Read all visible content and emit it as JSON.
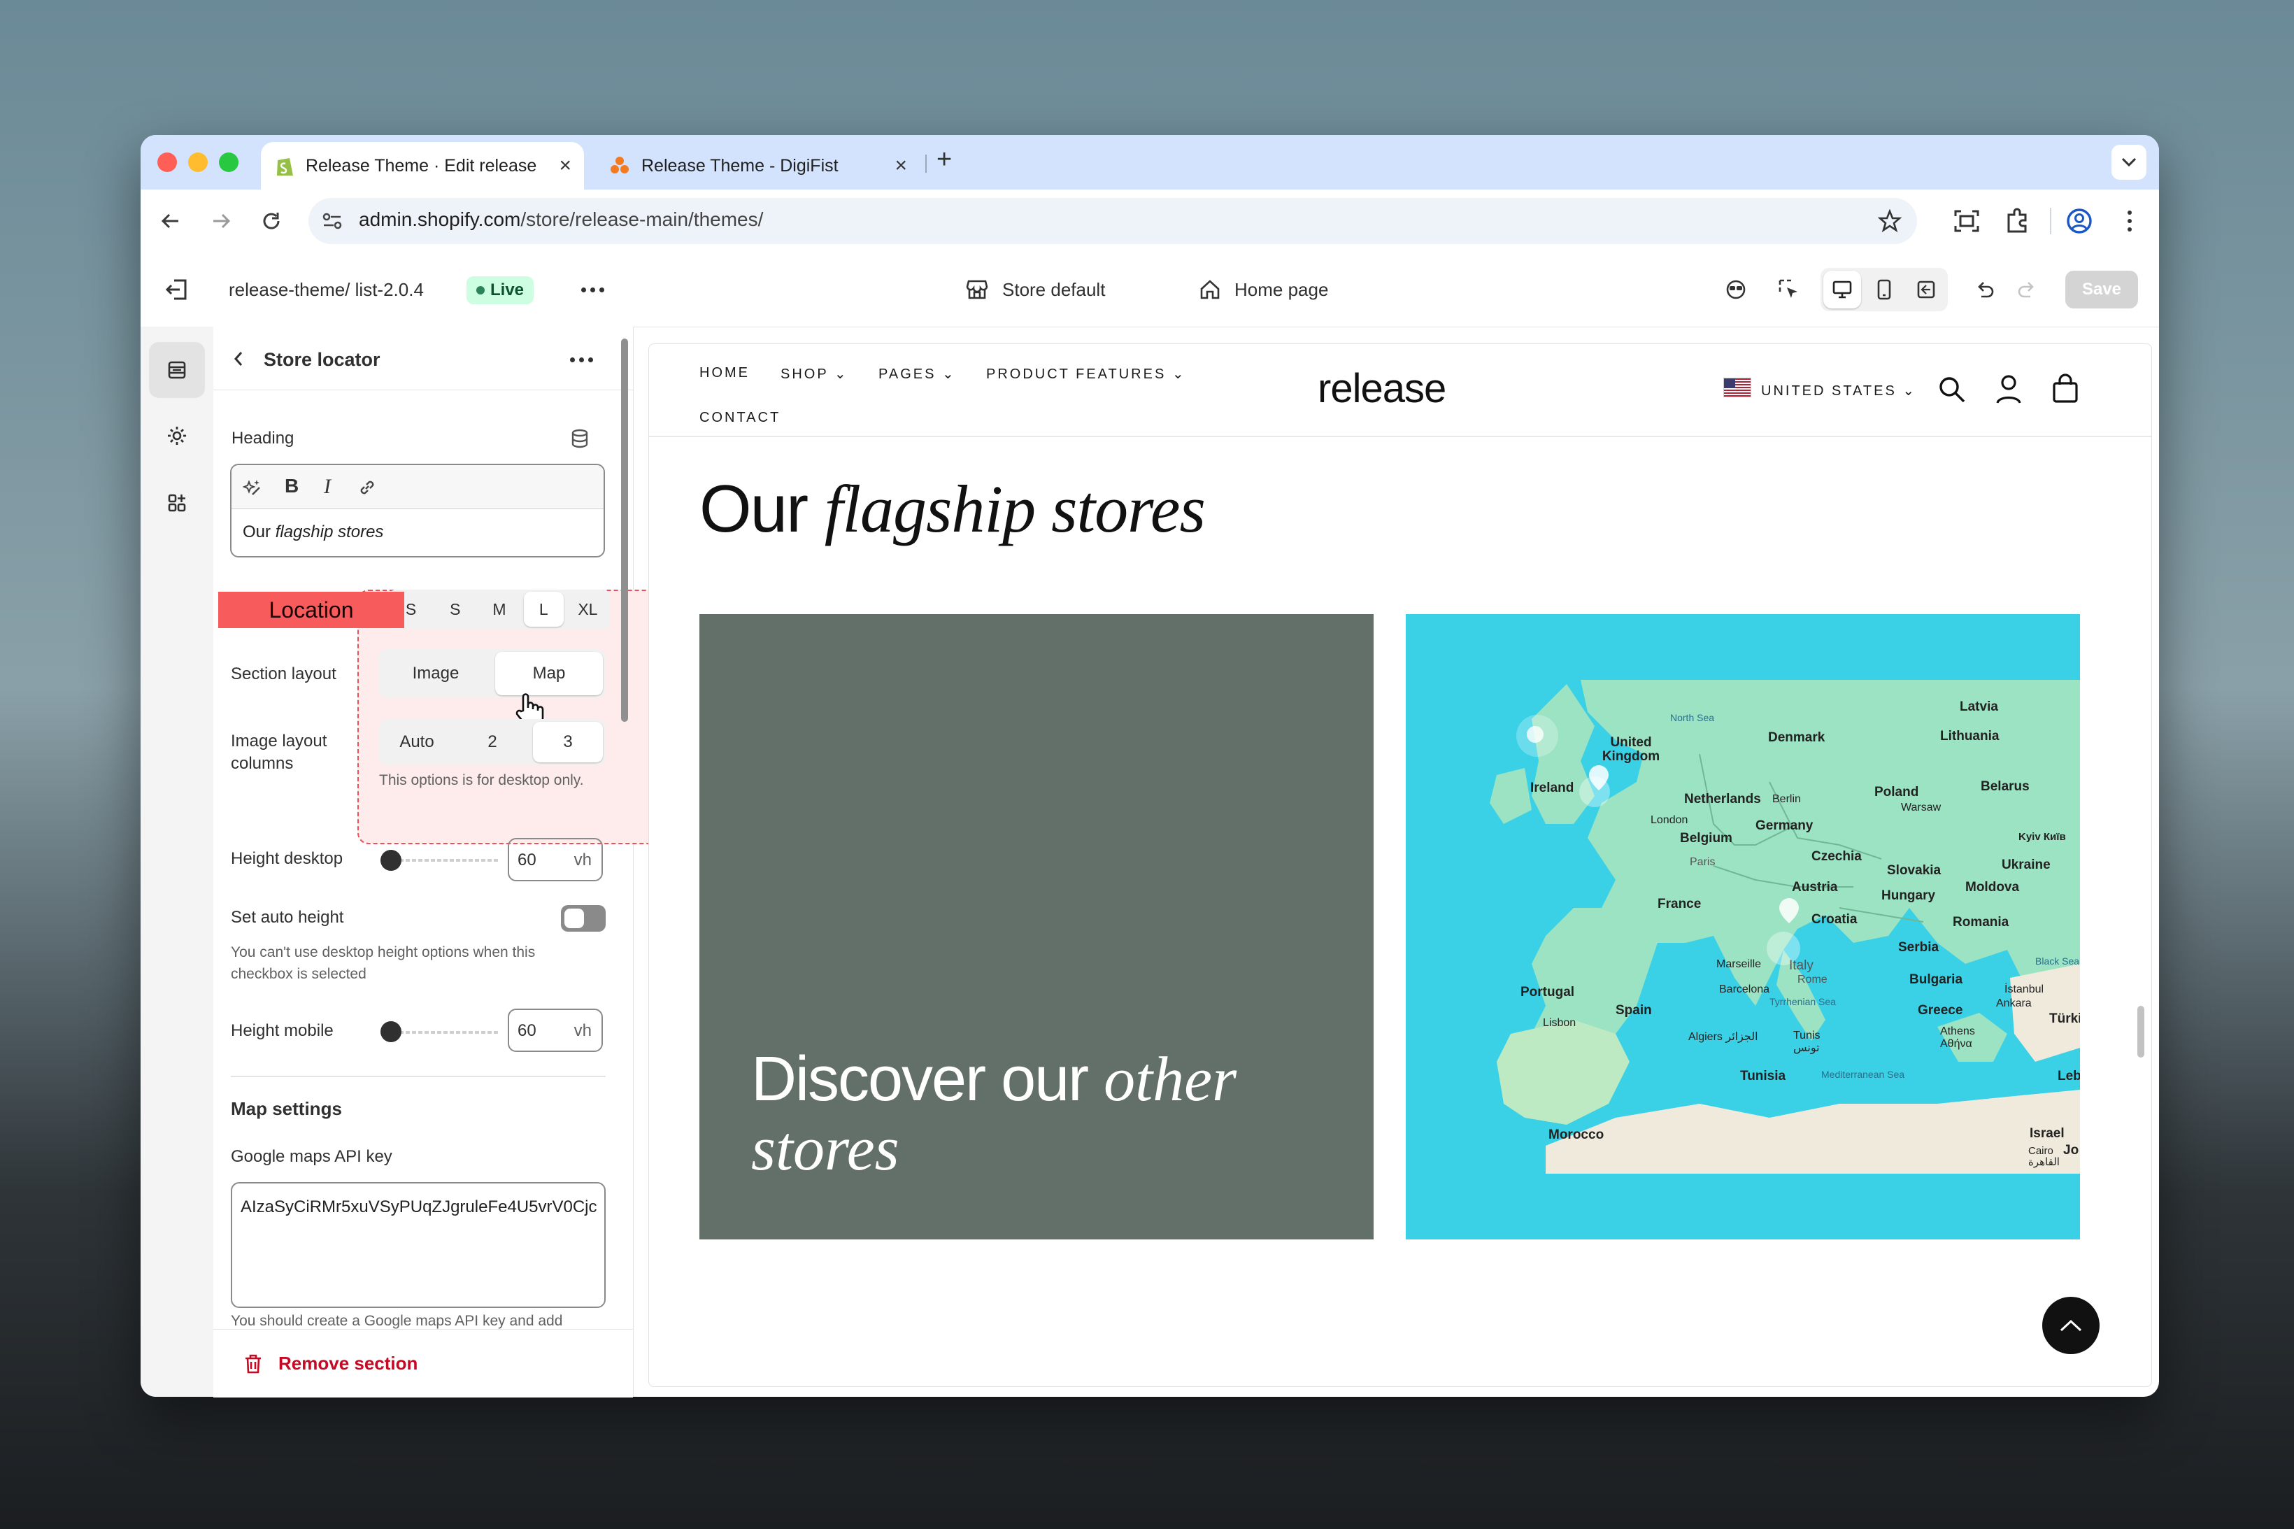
{
  "browser": {
    "tabs": [
      {
        "title": "Release Theme · Edit release-",
        "icon": "shopify-icon",
        "active": true
      },
      {
        "title": "Release Theme - DigiFist",
        "icon": "digifist-icon",
        "active": false
      }
    ],
    "new_tab": "+",
    "url_host": "admin.shopify.com",
    "url_path": "/store/release-main/themes/"
  },
  "editor": {
    "theme_name": "release-theme/ list-2.0.4",
    "live_badge": "Live",
    "store_context": "Store default",
    "page_context": "Home page",
    "save_label": "Save"
  },
  "panel": {
    "title": "Store locator",
    "heading_label": "Heading",
    "heading_value_plain": "Our ",
    "heading_value_italic": "flagship stores",
    "location_tag": "Location",
    "size_options": [
      "S",
      "S",
      "M",
      "L",
      "XL"
    ],
    "size_selected": "L",
    "section_layout_label": "Section layout",
    "section_layout_options": [
      "Image",
      "Map"
    ],
    "section_layout_selected": "Map",
    "image_cols_label": "Image layout columns",
    "image_cols_options": [
      "Auto",
      "2",
      "3"
    ],
    "image_cols_selected": "3",
    "image_cols_help": "This options is for desktop only.",
    "height_desktop_label": "Height desktop",
    "height_desktop_value": "60",
    "height_unit": "vh",
    "auto_height_label": "Set auto height",
    "auto_height_help": "You can't use desktop height options when this checkbox is selected",
    "height_mobile_label": "Height mobile",
    "height_mobile_value": "60",
    "map_settings_title": "Map settings",
    "api_key_label": "Google maps API key",
    "api_key_value": "AIzaSyCiRMr5xuVSyPUqZJgruleFe4U5vrV0Cjc",
    "api_key_help": "You should create a Google maps API key and add",
    "remove_label": "Remove section"
  },
  "storefront": {
    "nav": [
      "HOME",
      "SHOP",
      "PAGES",
      "PRODUCT FEATURES",
      "CONTACT"
    ],
    "logo": "release",
    "country": "UNITED STATES",
    "heading_plain": "Our ",
    "heading_italic": "flagship stores",
    "card_plain": "Discover our ",
    "card_italic": "other stores",
    "map_labels": {
      "north_sea": "North Sea",
      "uk": "United Kingdom",
      "denmark": "Denmark",
      "latvia": "Latvia",
      "lithuania": "Lithuania",
      "ireland": "Ireland",
      "netherlands": "Netherlands",
      "berlin": "Berlin",
      "poland": "Poland",
      "warsaw": "Warsaw",
      "belarus": "Belarus",
      "germany": "Germany",
      "belgium": "Belgium",
      "london": "London",
      "paris": "Paris",
      "czechia": "Czechia",
      "kyiv": "Kyiv Київ",
      "ukraine": "Ukraine",
      "slovakia": "Slovakia",
      "austria": "Austria",
      "moldova": "Moldova",
      "hungary": "Hungary",
      "france": "France",
      "croatia": "Croatia",
      "romania": "Romania",
      "marseille": "Marseille",
      "italy": "Italy",
      "serbia": "Serbia",
      "black_sea": "Black Sea",
      "rome": "Rome",
      "bulgaria": "Bulgaria",
      "portugal": "Portugal",
      "barcelona": "Barcelona",
      "istanbul": "İstanbul",
      "ankara": "Ankara",
      "tyrrhenian": "Tyrrhenian Sea",
      "spain": "Spain",
      "greece": "Greece",
      "turkey": "Türki",
      "athens": "Athens Αθήνα",
      "lisbon": "Lisbon",
      "algiers": "Algiers الجزائر",
      "tunis": "Tunis تونس",
      "tunisia": "Tunisia",
      "med": "Mediterranean Sea",
      "lebanon": "Leba",
      "morocco": "Morocco",
      "israel": "Israel",
      "cairo": "Cairo القاهرة",
      "jordan": "Jo"
    }
  },
  "colors": {
    "live_bg": "#cdfee1",
    "location_tag": "#f75b5b",
    "remove_red": "#c70a24",
    "card_grey": "#63706a",
    "map_sea": "#3ad1e6",
    "map_land": "#9be3c3"
  }
}
